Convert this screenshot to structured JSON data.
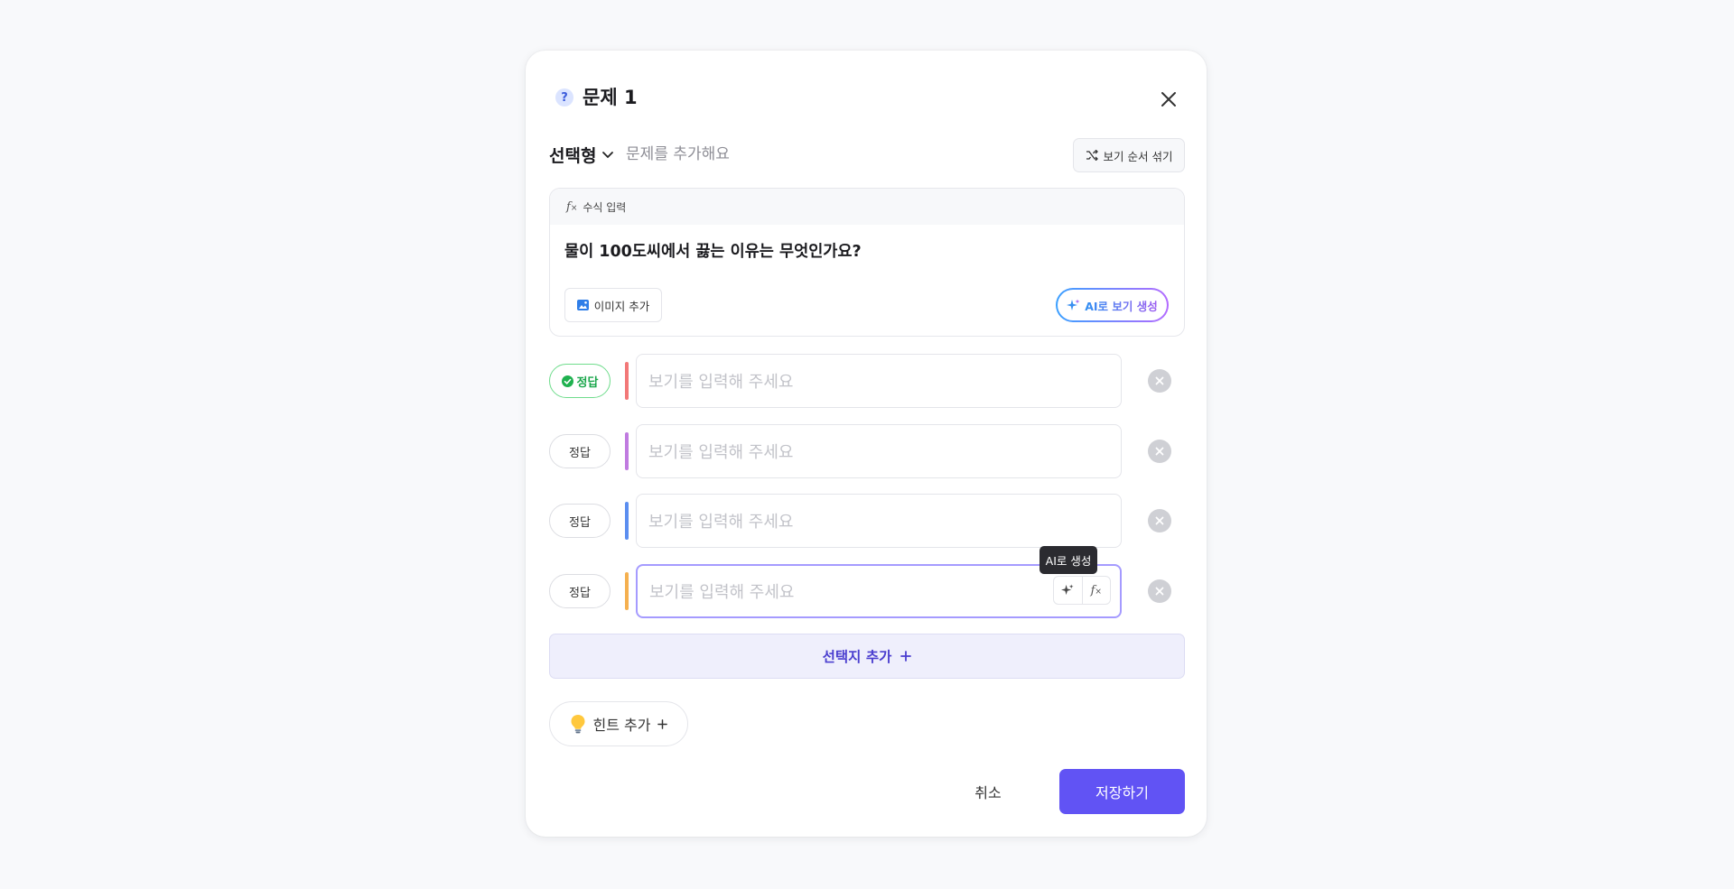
{
  "modal": {
    "question_badge": "?",
    "title": "문제 1",
    "type_label": "선택형",
    "question_placeholder": "문제를 추가해요",
    "shuffle_label": "보기 순서 섞기"
  },
  "question_box": {
    "formula_label": "수식 입력",
    "question_text": "물이 100도씨에서 끓는 이유는 무엇인가요?",
    "image_button_label": "이미지 추가",
    "ai_button_label": "AI로 보기 생성"
  },
  "choices": [
    {
      "answer_label": "정답",
      "correct": true,
      "bar_color": "#f27878",
      "placeholder": "보기를 입력해 주세요"
    },
    {
      "answer_label": "정답",
      "correct": false,
      "bar_color": "#c07be0",
      "placeholder": "보기를 입력해 주세요"
    },
    {
      "answer_label": "정답",
      "correct": false,
      "bar_color": "#5b8ef0",
      "placeholder": "보기를 입력해 주세요"
    },
    {
      "answer_label": "정답",
      "correct": false,
      "bar_color": "#f5b04f",
      "placeholder": "보기를 입력해 주세요"
    }
  ],
  "tooltip": "AI로 생성",
  "add_choice_label": "선택지 추가",
  "hint_label": "힌트 추가",
  "footer": {
    "cancel_label": "취소",
    "save_label": "저장하기"
  },
  "colors": {
    "accent": "#6153f4",
    "correct_green": "#1aa64b"
  }
}
